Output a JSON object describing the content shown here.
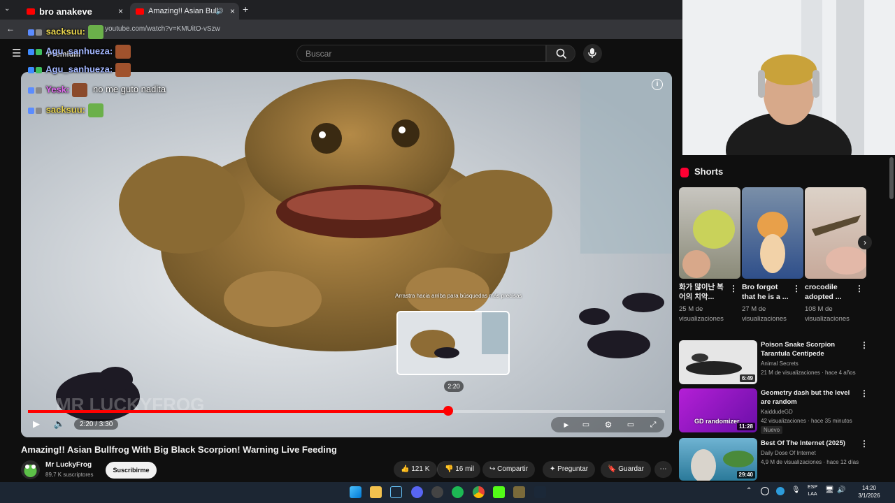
{
  "browser": {
    "tabs": [
      {
        "label": "bro anakeve"
      },
      {
        "label": "Amazing!! Asian Bullfrog W"
      }
    ],
    "url": "youtube.com/watch?v=KMUitO-vSzw"
  },
  "header": {
    "search_placeholder": "Buscar",
    "premium_label": "Premium"
  },
  "chat": [
    {
      "user": "sacksuu:",
      "color": "#e8d44d",
      "message": ""
    },
    {
      "user": "Agu_sanhueza:",
      "color": "#a3b7ff",
      "message": ""
    },
    {
      "user": "Agu_sanhueza:",
      "color": "#a3b7ff",
      "message": ""
    },
    {
      "user": "Yesk:",
      "color": "#e06df0",
      "message": "no me guto nadita"
    },
    {
      "user": "sacksuu:",
      "color": "#e8d44d",
      "message": ""
    }
  ],
  "player": {
    "current_time": "2:20",
    "duration": "3:30",
    "timecode": "2:20 / 3:30",
    "preview_time": "2:20",
    "preview_hint": "Arrastra hacia arriba para búsquedas más precisas",
    "progress": 0.66,
    "accent": "#ff0000"
  },
  "video": {
    "title": "Amazing!! Asian Bullfrog With Big Black Scorpion! Warning Live Feeding",
    "channel": "Mr LuckyFrog",
    "subscribers": "89,7 K suscriptores",
    "subscribe_label": "Suscribirme",
    "likes": "121 K",
    "dislikes": "16 mil",
    "share_label": "Compartir",
    "ask_label": "Preguntar",
    "save_label": "Guardar"
  },
  "shorts": {
    "heading": "Shorts",
    "items": [
      {
        "title": "화가 많이난 복어의 치악...",
        "views": "25 M de visualizaciones"
      },
      {
        "title": "Bro forgot that he is a ...",
        "views": "27 M de visualizaciones"
      },
      {
        "title": "crocodile adopted ...",
        "views": "108 M de visualizaciones"
      }
    ]
  },
  "recommendations": [
    {
      "title": "Poison Snake Scorpion Tarantula Centipede",
      "channel": "Animal Secrets",
      "meta": "21 M de visualizaciones · hace 4 años",
      "duration": "6:49",
      "badge": ""
    },
    {
      "title": "Geometry dash but the level are random",
      "channel": "KaiddudeGD",
      "meta": "42 visualizaciones · hace 35 minutos",
      "duration": "11:28",
      "badge": "Nuevo",
      "thumb_text": "GD randomizer"
    },
    {
      "title": "Best Of The Internet (2025)",
      "channel": "Daily Dose Of Internet",
      "meta": "4,9 M de visualizaciones · hace 12 días",
      "duration": "29:40",
      "badge": ""
    }
  ],
  "taskbar": {
    "lang_top": "ESP",
    "lang_bottom": "LAA",
    "time": "14:20",
    "date": "3/1/2026"
  },
  "icons": [
    "menu-icon",
    "search-icon",
    "mic-icon",
    "info-icon",
    "play-icon",
    "volume-icon",
    "autoplay-icon",
    "subtitles-icon",
    "settings-icon",
    "theater-icon",
    "fullscreen-icon",
    "like-icon",
    "dislike-icon",
    "share-icon",
    "sparkle-icon",
    "bookmark-icon",
    "more-icon",
    "chevron-right-icon"
  ]
}
